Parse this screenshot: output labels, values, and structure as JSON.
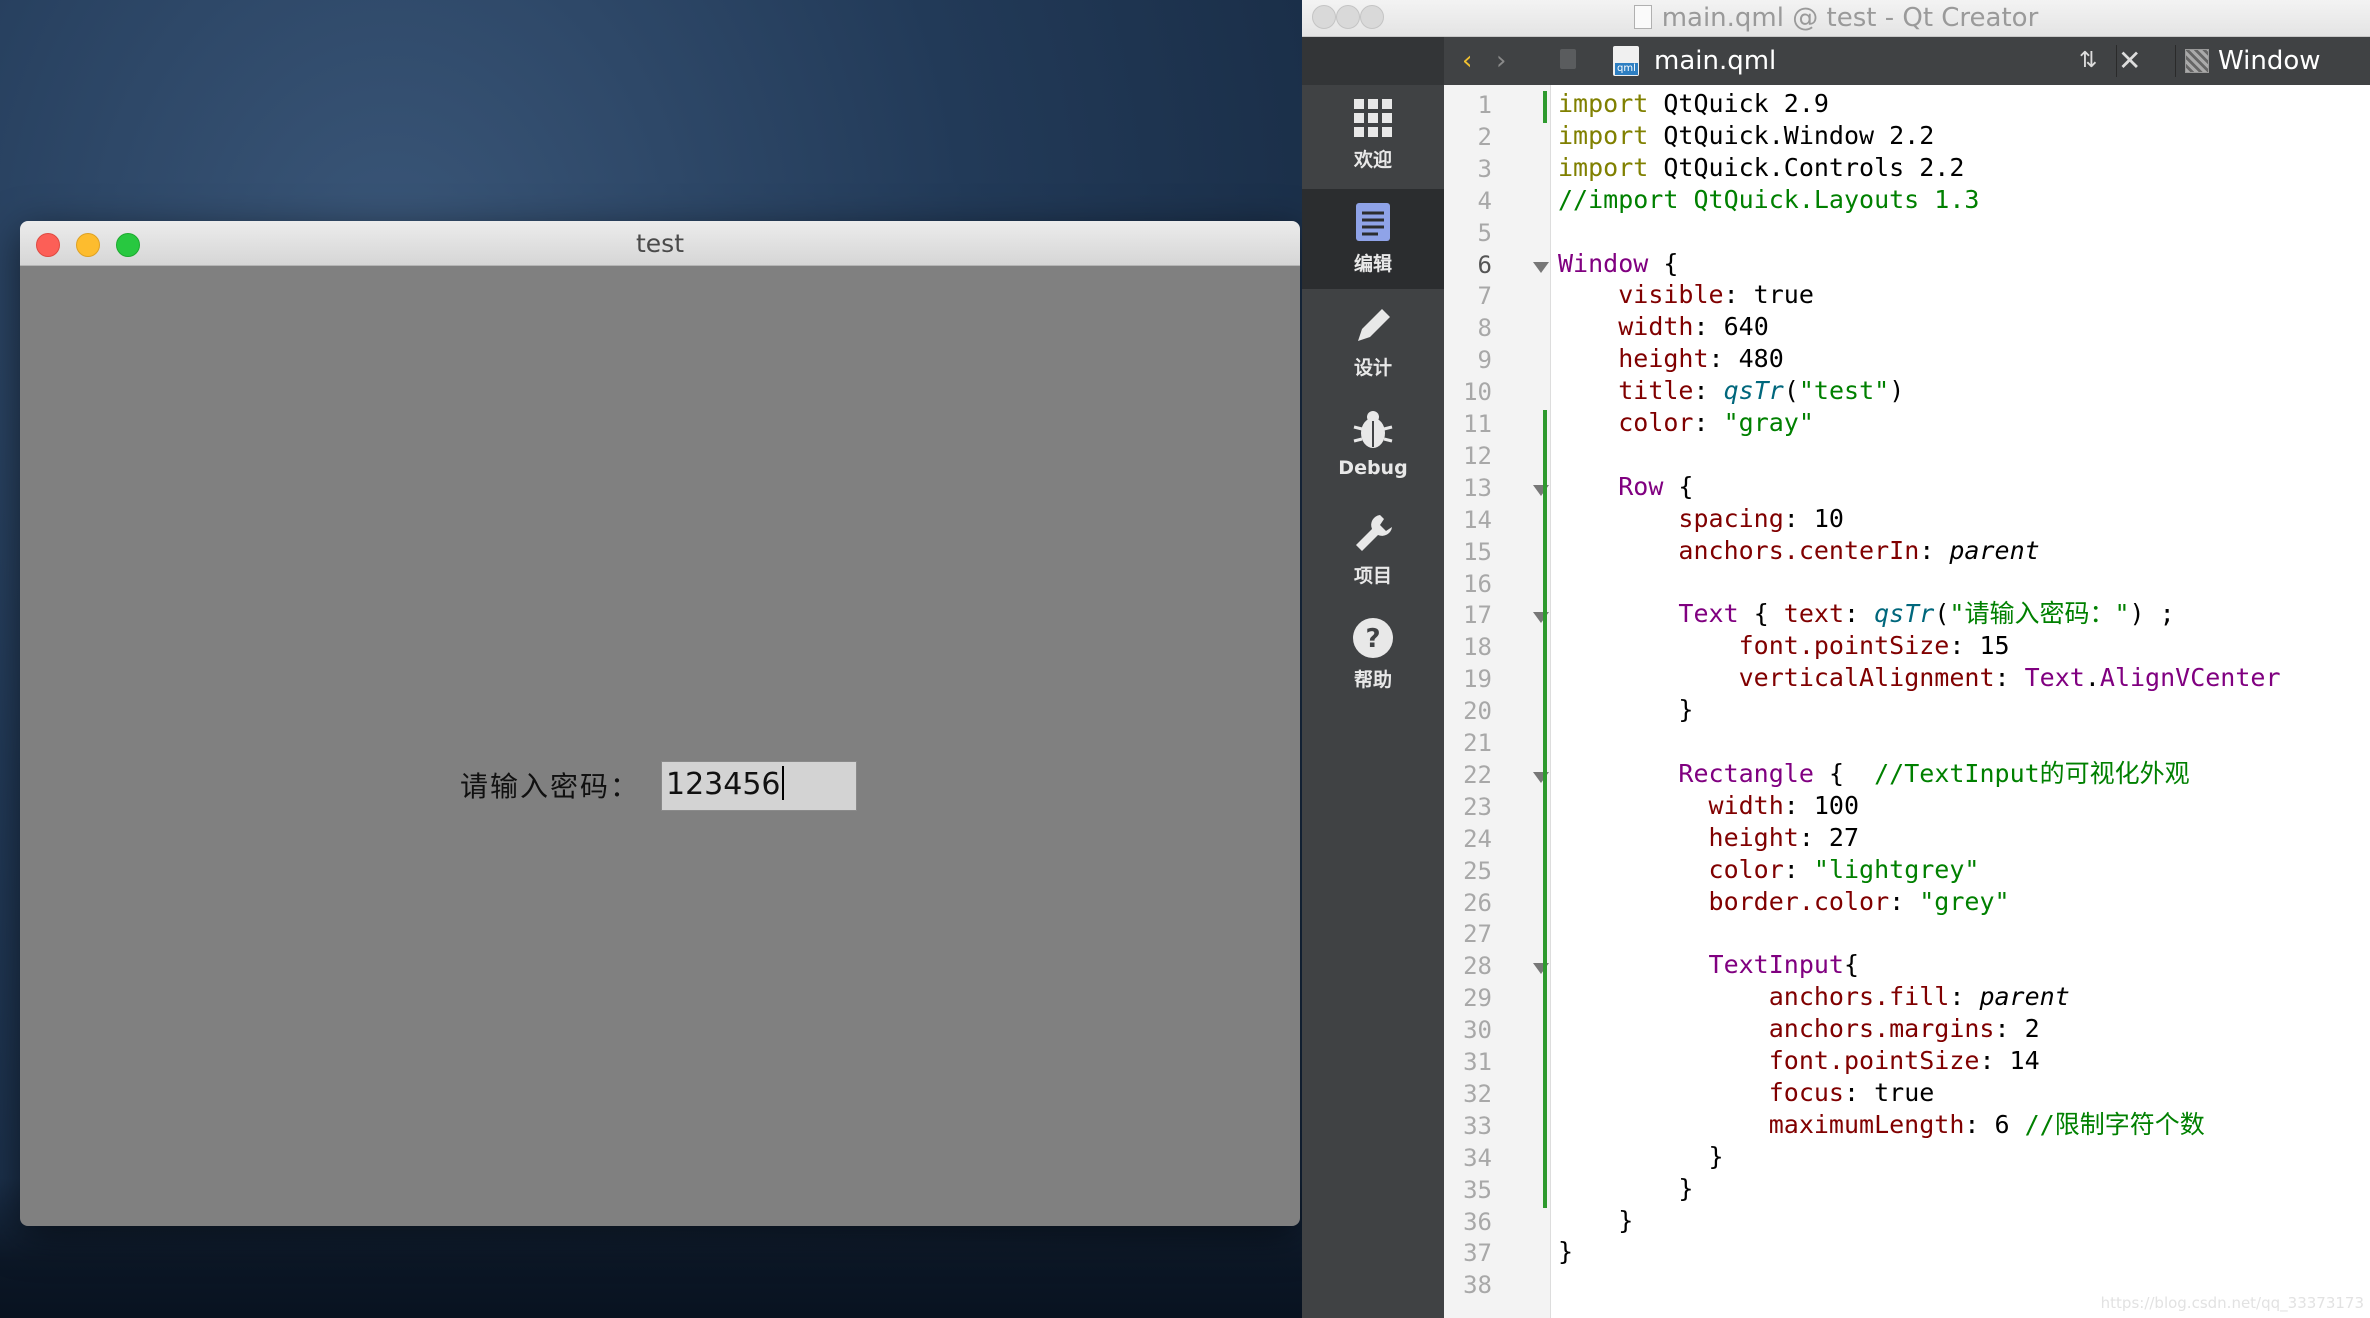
{
  "test_window": {
    "title": "test",
    "password_label": "请输入密码：",
    "password_value": "123456"
  },
  "qt_creator": {
    "title": "main.qml @ test - Qt Creator",
    "toolbar": {
      "file": "main.qml",
      "symbol": "Window"
    },
    "sidebar": [
      {
        "label": "欢迎",
        "icon": "grid-icon"
      },
      {
        "label": "编辑",
        "icon": "document-icon"
      },
      {
        "label": "设计",
        "icon": "pencil-icon"
      },
      {
        "label": "Debug",
        "icon": "bug-icon"
      },
      {
        "label": "项目",
        "icon": "wrench-icon"
      },
      {
        "label": "帮助",
        "icon": "help-icon"
      }
    ],
    "line_numbers": [
      "1",
      "2",
      "3",
      "4",
      "5",
      "6",
      "7",
      "8",
      "9",
      "10",
      "11",
      "12",
      "13",
      "14",
      "15",
      "16",
      "17",
      "18",
      "19",
      "20",
      "21",
      "22",
      "23",
      "24",
      "25",
      "26",
      "27",
      "28",
      "29",
      "30",
      "31",
      "32",
      "33",
      "34",
      "35",
      "36",
      "37",
      "38"
    ],
    "code": [
      [
        {
          "t": "import",
          "c": "k-imp"
        },
        {
          "t": " QtQuick 2.9"
        }
      ],
      [
        {
          "t": "import",
          "c": "k-imp"
        },
        {
          "t": " QtQuick.Window 2.2"
        }
      ],
      [
        {
          "t": "import",
          "c": "k-imp"
        },
        {
          "t": " QtQuick.Controls 2.2"
        }
      ],
      [
        {
          "t": "//import QtQuick.Layouts 1.3",
          "c": "k-com"
        }
      ],
      [],
      [
        {
          "t": "Window",
          "c": "k-type"
        },
        {
          "t": " {"
        }
      ],
      [
        {
          "t": "    "
        },
        {
          "t": "visible",
          "c": "k-prop"
        },
        {
          "t": ": true"
        }
      ],
      [
        {
          "t": "    "
        },
        {
          "t": "width",
          "c": "k-prop"
        },
        {
          "t": ": 640"
        }
      ],
      [
        {
          "t": "    "
        },
        {
          "t": "height",
          "c": "k-prop"
        },
        {
          "t": ": 480"
        }
      ],
      [
        {
          "t": "    "
        },
        {
          "t": "title",
          "c": "k-prop"
        },
        {
          "t": ": "
        },
        {
          "t": "qsTr",
          "c": "k-fn"
        },
        {
          "t": "("
        },
        {
          "t": "\"test\"",
          "c": "k-str"
        },
        {
          "t": ")"
        }
      ],
      [
        {
          "t": "    "
        },
        {
          "t": "color",
          "c": "k-prop"
        },
        {
          "t": ": "
        },
        {
          "t": "\"gray\"",
          "c": "k-str"
        }
      ],
      [],
      [
        {
          "t": "    "
        },
        {
          "t": "Row",
          "c": "k-type"
        },
        {
          "t": " {"
        }
      ],
      [
        {
          "t": "        "
        },
        {
          "t": "spacing",
          "c": "k-prop"
        },
        {
          "t": ": 10"
        }
      ],
      [
        {
          "t": "        "
        },
        {
          "t": "anchors.centerIn",
          "c": "k-prop"
        },
        {
          "t": ": "
        },
        {
          "t": "parent",
          "c": "k-it"
        }
      ],
      [],
      [
        {
          "t": "        "
        },
        {
          "t": "Text",
          "c": "k-type"
        },
        {
          "t": " { "
        },
        {
          "t": "text",
          "c": "k-prop"
        },
        {
          "t": ": "
        },
        {
          "t": "qsTr",
          "c": "k-fn"
        },
        {
          "t": "("
        },
        {
          "t": "\"请输入密码：\"",
          "c": "k-str"
        },
        {
          "t": ") ;"
        }
      ],
      [
        {
          "t": "            "
        },
        {
          "t": "font.pointSize",
          "c": "k-prop"
        },
        {
          "t": ": 15"
        }
      ],
      [
        {
          "t": "            "
        },
        {
          "t": "verticalAlignment",
          "c": "k-prop"
        },
        {
          "t": ": "
        },
        {
          "t": "Text",
          "c": "k-enum"
        },
        {
          "t": "."
        },
        {
          "t": "AlignVCenter",
          "c": "k-enum"
        }
      ],
      [
        {
          "t": "        }"
        }
      ],
      [],
      [
        {
          "t": "        "
        },
        {
          "t": "Rectangle",
          "c": "k-type"
        },
        {
          "t": " {  "
        },
        {
          "t": "//TextInput的可视化外观",
          "c": "k-com"
        }
      ],
      [
        {
          "t": "          "
        },
        {
          "t": "width",
          "c": "k-prop"
        },
        {
          "t": ": 100"
        }
      ],
      [
        {
          "t": "          "
        },
        {
          "t": "height",
          "c": "k-prop"
        },
        {
          "t": ": 27"
        }
      ],
      [
        {
          "t": "          "
        },
        {
          "t": "color",
          "c": "k-prop"
        },
        {
          "t": ": "
        },
        {
          "t": "\"lightgrey\"",
          "c": "k-str"
        }
      ],
      [
        {
          "t": "          "
        },
        {
          "t": "border.color",
          "c": "k-prop"
        },
        {
          "t": ": "
        },
        {
          "t": "\"grey\"",
          "c": "k-str"
        }
      ],
      [],
      [
        {
          "t": "          "
        },
        {
          "t": "TextInput",
          "c": "k-type"
        },
        {
          "t": "{"
        }
      ],
      [
        {
          "t": "              "
        },
        {
          "t": "anchors.fill",
          "c": "k-prop"
        },
        {
          "t": ": "
        },
        {
          "t": "parent",
          "c": "k-it"
        }
      ],
      [
        {
          "t": "              "
        },
        {
          "t": "anchors.margins",
          "c": "k-prop"
        },
        {
          "t": ": 2"
        }
      ],
      [
        {
          "t": "              "
        },
        {
          "t": "font.pointSize",
          "c": "k-prop"
        },
        {
          "t": ": 14"
        }
      ],
      [
        {
          "t": "              "
        },
        {
          "t": "focus",
          "c": "k-prop"
        },
        {
          "t": ": true"
        }
      ],
      [
        {
          "t": "              "
        },
        {
          "t": "maximumLength",
          "c": "k-prop"
        },
        {
          "t": ": 6 "
        },
        {
          "t": "//限制字符个数",
          "c": "k-com"
        }
      ],
      [
        {
          "t": "          }"
        }
      ],
      [
        {
          "t": "        }"
        }
      ],
      [
        {
          "t": "    }"
        }
      ],
      [
        {
          "t": "}"
        }
      ],
      []
    ],
    "fold_lines": [
      6,
      13,
      17,
      22,
      28
    ],
    "watermark": "https://blog.csdn.net/qq_33373173"
  }
}
